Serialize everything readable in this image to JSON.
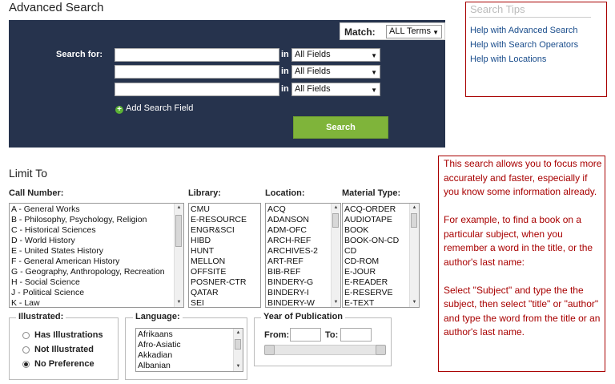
{
  "page_title": "Advanced Search",
  "search_panel": {
    "match_label": "Match:",
    "match_value": "ALL Terms",
    "search_for_label": "Search for:",
    "rows": [
      {
        "value": "",
        "in_label": "in",
        "field": "All Fields"
      },
      {
        "value": "",
        "in_label": "in",
        "field": "All Fields"
      },
      {
        "value": "",
        "in_label": "in",
        "field": "All Fields"
      }
    ],
    "add_field_label": "Add Search Field",
    "search_button": "Search"
  },
  "search_tips": {
    "title": "Search Tips",
    "links": [
      "Help with Advanced Search",
      "Help with Search Operators",
      "Help with Locations"
    ]
  },
  "limit_to": {
    "title": "Limit To",
    "call_number": {
      "label": "Call Number:",
      "items": [
        "A - General Works",
        "B - Philosophy, Psychology, Religion",
        "C - Historical Sciences",
        "D - World History",
        "E - United States History",
        "F - General American History",
        "G - Geography, Anthropology, Recreation",
        "H - Social Science",
        "J - Political Science",
        "K - Law"
      ]
    },
    "library": {
      "label": "Library:",
      "items": [
        "CMU",
        "E-RESOURCE",
        "ENGR&SCI",
        "HIBD",
        "HUNT",
        "MELLON",
        "OFFSITE",
        "POSNER-CTR",
        "QATAR",
        "SEI"
      ]
    },
    "location": {
      "label": "Location:",
      "items": [
        "ACQ",
        "ADANSON",
        "ADM-OFC",
        "ARCH-REF",
        "ARCHIVES-2",
        "ART-REF",
        "BIB-REF",
        "BINDERY-G",
        "BINDERY-I",
        "BINDERY-W"
      ]
    },
    "material_type": {
      "label": "Material Type:",
      "items": [
        "ACQ-ORDER",
        "AUDIOTAPE",
        "BOOK",
        "BOOK-ON-CD",
        "CD",
        "CD-ROM",
        "E-JOUR",
        "E-READER",
        "E-RESERVE",
        "E-TEXT"
      ]
    },
    "illustrated": {
      "label": "Illustrated:",
      "options": [
        "Has Illustrations",
        "Not Illustrated",
        "No Preference"
      ],
      "selected": "No Preference"
    },
    "language": {
      "label": "Language:",
      "items": [
        "Afrikaans",
        "Afro-Asiatic",
        "Akkadian",
        "Albanian"
      ]
    },
    "year": {
      "label": "Year of Publication",
      "from_label": "From:",
      "to_label": "To:",
      "from_value": "",
      "to_value": ""
    }
  },
  "help_note": {
    "paragraphs": [
      "This search allows you to focus more accurately and faster, especially if you know some information already.",
      "For example, to find a book on a particular subject, when you remember a word in the title, or the author's last name:",
      "Select \"Subject\" and type the the subject, then select \"title\" or \"author\" and type the word from the title or an author's last name."
    ]
  }
}
